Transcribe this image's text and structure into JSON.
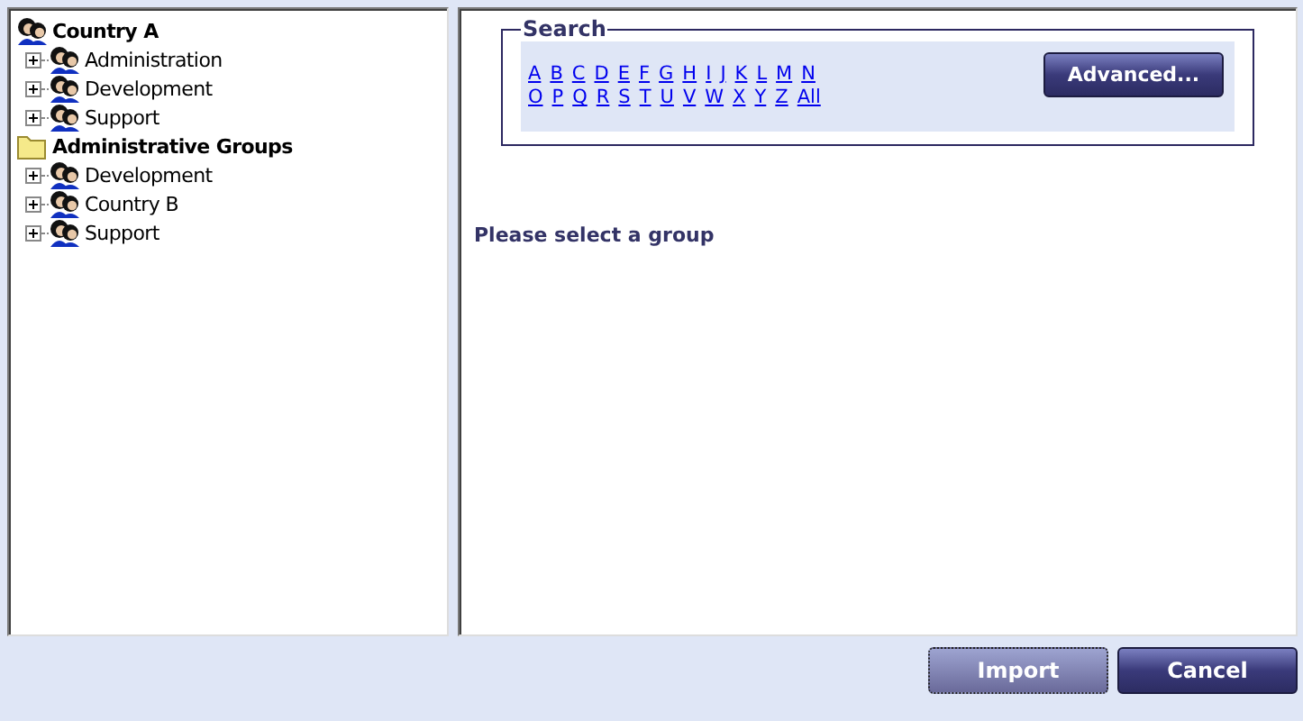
{
  "tree": [
    {
      "label": "Country A",
      "kind": "group",
      "children": [
        {
          "label": "Administration",
          "kind": "group",
          "expanded": false
        },
        {
          "label": "Development",
          "kind": "group",
          "expanded": false
        },
        {
          "label": "Support",
          "kind": "group",
          "expanded": false
        }
      ]
    },
    {
      "label": "Administrative Groups",
      "kind": "folder",
      "children": [
        {
          "label": "Development",
          "kind": "group",
          "expanded": false
        },
        {
          "label": "Country B",
          "kind": "group",
          "expanded": false
        },
        {
          "label": "Support",
          "kind": "group",
          "expanded": false
        }
      ]
    }
  ],
  "search": {
    "legend": "Search",
    "letter_rows": [
      [
        "A",
        "B",
        "C",
        "D",
        "E",
        "F",
        "G",
        "H",
        "I",
        "J",
        "K",
        "L",
        "M",
        "N"
      ],
      [
        "O",
        "P",
        "Q",
        "R",
        "S",
        "T",
        "U",
        "V",
        "W",
        "X",
        "Y",
        "Z",
        "All"
      ]
    ],
    "advanced_button": "Advanced..."
  },
  "message": "Please select a group",
  "buttons": [
    {
      "label": "Import",
      "disabled": true
    },
    {
      "label": "Cancel",
      "disabled": false
    }
  ]
}
